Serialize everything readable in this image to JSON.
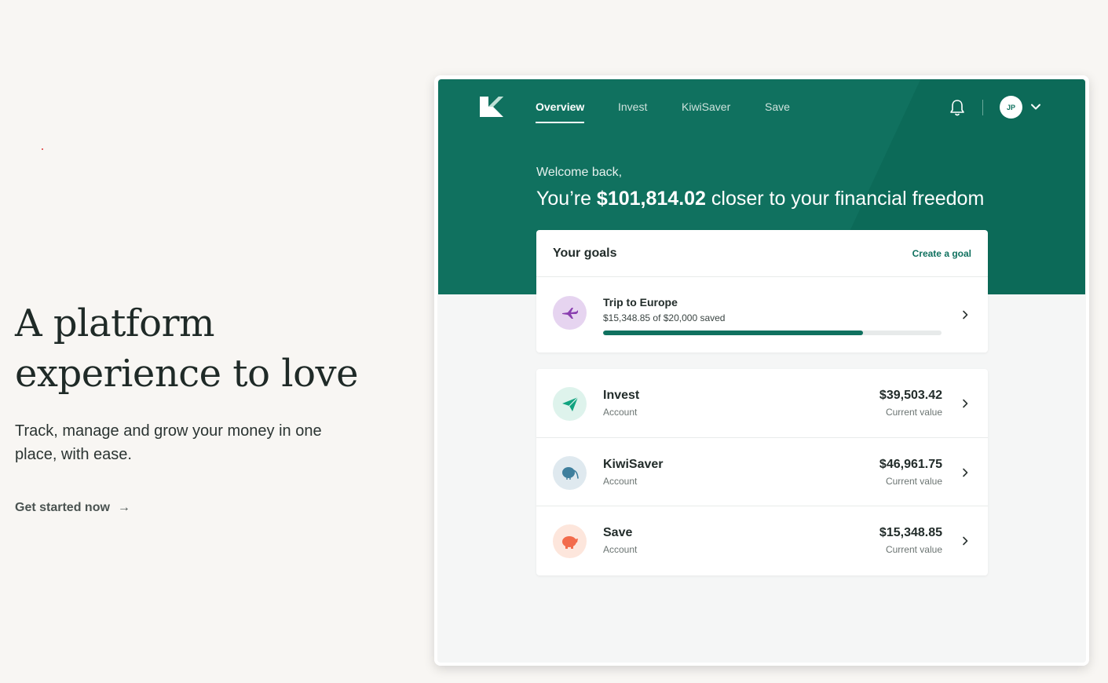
{
  "hero": {
    "title_line1": "A platform",
    "title_line2": "experience to love",
    "subtitle": "Track, manage and grow your money in one place, with ease.",
    "cta_label": "Get started now",
    "cta_arrow": "→"
  },
  "app": {
    "nav": {
      "items": [
        {
          "label": "Overview",
          "active": true
        },
        {
          "label": "Invest",
          "active": false
        },
        {
          "label": "KiwiSaver",
          "active": false
        },
        {
          "label": "Save",
          "active": false
        }
      ],
      "avatar_initials": "JP"
    },
    "welcome": "Welcome back,",
    "freedom_prefix": "You’re ",
    "freedom_amount": "$101,814.02",
    "freedom_suffix": " closer to your financial freedom",
    "goals": {
      "title": "Your goals",
      "create_label": "Create a goal",
      "items": [
        {
          "name": "Trip to Europe",
          "progress_text": "$15,348.85 of $20,000 saved",
          "progress_fraction": 0.767,
          "icon": "plane-icon"
        }
      ]
    },
    "accounts": [
      {
        "name": "Invest",
        "type": "Account",
        "value": "$39,503.42",
        "value_label": "Current value",
        "icon": "paper-plane-icon",
        "icon_bg": "#def3ec",
        "icon_color": "#10a37f"
      },
      {
        "name": "KiwiSaver",
        "type": "Account",
        "value": "$46,961.75",
        "value_label": "Current value",
        "icon": "kiwi-bird-icon",
        "icon_bg": "#dfe9ef",
        "icon_color": "#3f7f9d"
      },
      {
        "name": "Save",
        "type": "Account",
        "value": "$15,348.85",
        "value_label": "Current value",
        "icon": "piggy-bank-icon",
        "icon_bg": "#fde6dc",
        "icon_color": "#f26b4b"
      }
    ],
    "colors": {
      "brand": "#10715f",
      "progress_track": "#e7eaea",
      "goal_icon_bg": "#e6d4f0"
    }
  }
}
